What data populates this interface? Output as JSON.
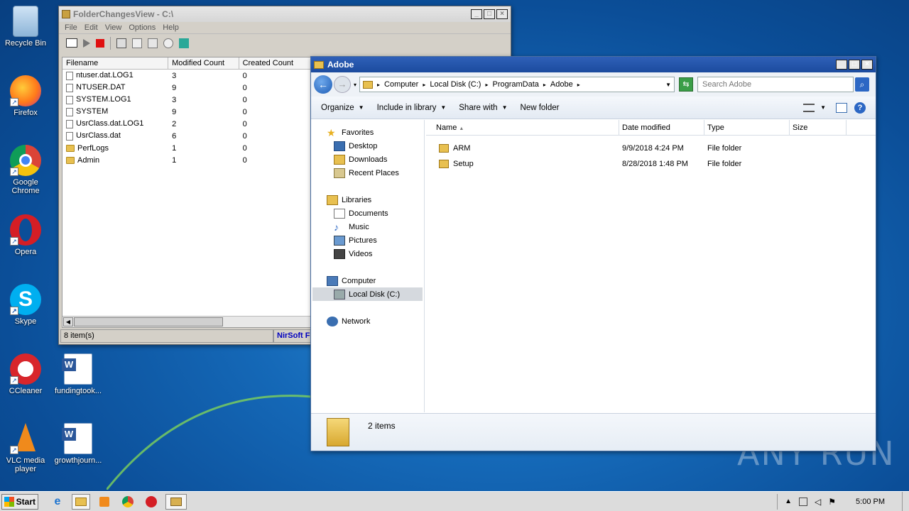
{
  "desktop": {
    "icons": [
      {
        "label": "Recycle Bin"
      },
      {
        "label": "Firefox"
      },
      {
        "label": "Google Chrome"
      },
      {
        "label": "Opera"
      },
      {
        "label": "Skype"
      },
      {
        "label": "CCleaner"
      },
      {
        "label": "fundingtook..."
      },
      {
        "label": "VLC media player"
      },
      {
        "label": "growthjourn..."
      }
    ],
    "watermark": "ANY RUN"
  },
  "fcv": {
    "title": "FolderChangesView - C:\\",
    "menu": [
      "File",
      "Edit",
      "View",
      "Options",
      "Help"
    ],
    "columns": [
      "Filename",
      "Modified Count",
      "Created Count"
    ],
    "rows": [
      {
        "name": "ntuser.dat.LOG1",
        "modified": "3",
        "created": "0",
        "kind": "file"
      },
      {
        "name": "NTUSER.DAT",
        "modified": "9",
        "created": "0",
        "kind": "file"
      },
      {
        "name": "SYSTEM.LOG1",
        "modified": "3",
        "created": "0",
        "kind": "file"
      },
      {
        "name": "SYSTEM",
        "modified": "9",
        "created": "0",
        "kind": "file"
      },
      {
        "name": "UsrClass.dat.LOG1",
        "modified": "2",
        "created": "0",
        "kind": "file"
      },
      {
        "name": "UsrClass.dat",
        "modified": "6",
        "created": "0",
        "kind": "file"
      },
      {
        "name": "PerfLogs",
        "modified": "1",
        "created": "0",
        "kind": "folder"
      },
      {
        "name": "Admin",
        "modified": "1",
        "created": "0",
        "kind": "folder"
      }
    ],
    "status_count": "8 item(s)",
    "status_brand": "NirSoft F"
  },
  "explorer": {
    "title": "Adobe",
    "breadcrumb": [
      "Computer",
      "Local Disk (C:)",
      "ProgramData",
      "Adobe"
    ],
    "search_placeholder": "Search Adobe",
    "commands": [
      "Organize",
      "Include in library",
      "Share with",
      "New folder"
    ],
    "nav": {
      "favorites": "Favorites",
      "favorites_items": [
        "Desktop",
        "Downloads",
        "Recent Places"
      ],
      "libraries": "Libraries",
      "libraries_items": [
        "Documents",
        "Music",
        "Pictures",
        "Videos"
      ],
      "computer": "Computer",
      "computer_items": [
        "Local Disk (C:)"
      ],
      "network": "Network"
    },
    "columns": [
      "Name",
      "Date modified",
      "Type",
      "Size"
    ],
    "rows": [
      {
        "name": "ARM",
        "date": "9/9/2018 4:24 PM",
        "type": "File folder",
        "size": ""
      },
      {
        "name": "Setup",
        "date": "8/28/2018 1:48 PM",
        "type": "File folder",
        "size": ""
      }
    ],
    "details_count": "2 items"
  },
  "taskbar": {
    "start": "Start",
    "clock": "5:00 PM"
  }
}
